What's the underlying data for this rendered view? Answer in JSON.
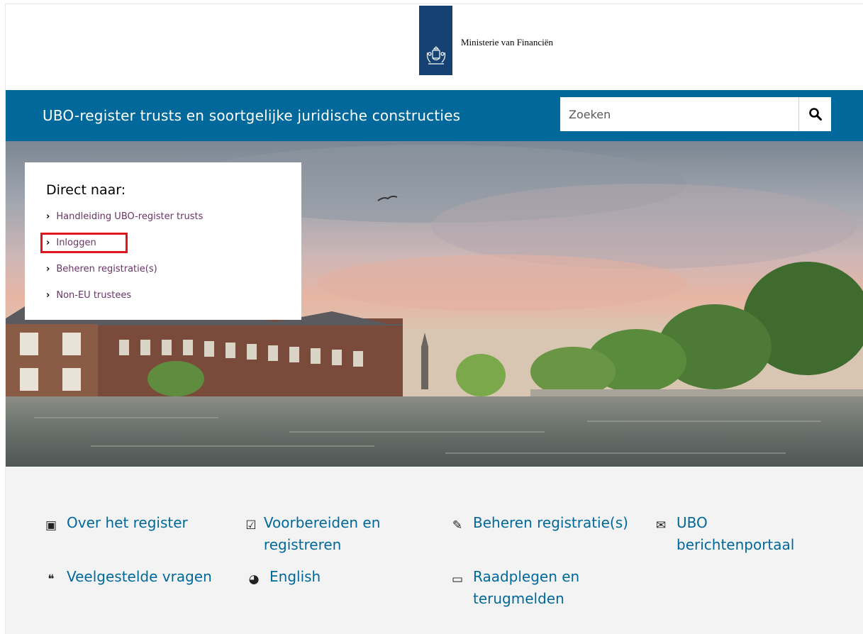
{
  "header": {
    "ministry_name": "Ministerie van Financiën"
  },
  "topbar": {
    "site_title": "UBO-register trusts en soortgelijke juridische constructies",
    "search_placeholder": "Zoeken"
  },
  "direct": {
    "title": "Direct naar:",
    "items": [
      {
        "label": "Handleiding UBO-register trusts"
      },
      {
        "label": "Inloggen"
      },
      {
        "label": "Beheren registratie(s)"
      },
      {
        "label": "Non-EU trustees"
      }
    ]
  },
  "quicknav": {
    "items": [
      {
        "label": "Over het register",
        "icon": "book-icon"
      },
      {
        "label": "Voorbereiden en registreren",
        "icon": "clipboard-icon"
      },
      {
        "label": "Beheren registratie(s)",
        "icon": "edit-document-icon"
      },
      {
        "label": "UBO berichtenportaal",
        "icon": "messages-icon"
      },
      {
        "label": "Veelgestelde vragen",
        "icon": "chat-question-icon"
      },
      {
        "label": "English",
        "icon": "globe-icon"
      },
      {
        "label": "Raadplegen en terugmelden",
        "icon": "monitor-icon"
      }
    ]
  },
  "colors": {
    "topbar": "#01689b",
    "logo_ribbon": "#154273",
    "link_purple": "#6b3368",
    "highlight_red": "#e0161b"
  }
}
